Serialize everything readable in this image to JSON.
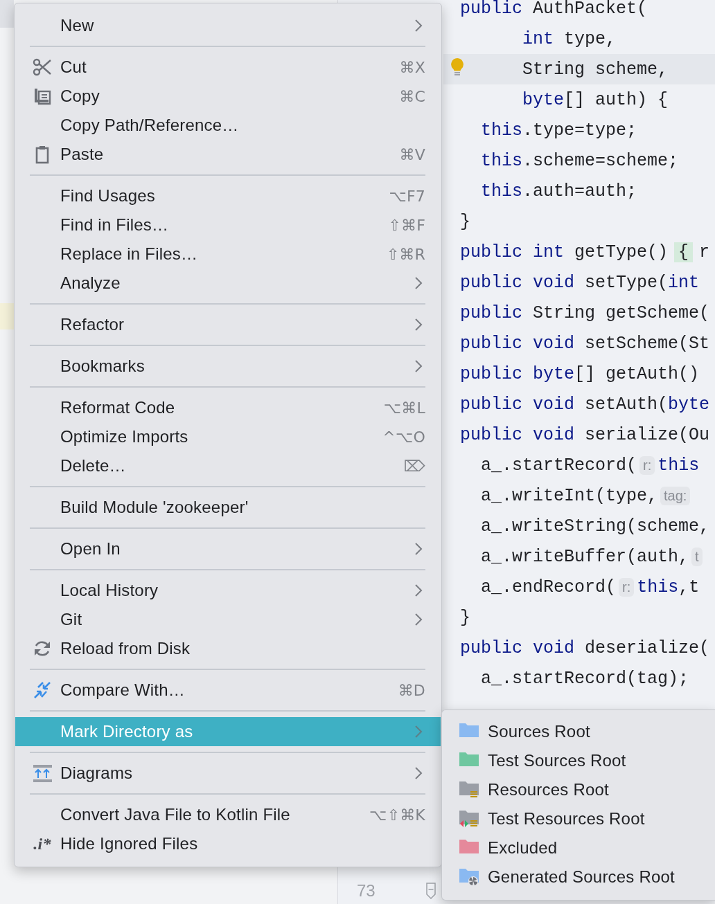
{
  "editor": {
    "lines": [
      {
        "current": false,
        "bulb": false,
        "segments": [
          {
            "kind": "keyword",
            "text": "public"
          },
          {
            "kind": "plain",
            "text": " AuthPacket("
          }
        ]
      },
      {
        "current": false,
        "bulb": false,
        "segments": [
          {
            "kind": "keyword",
            "text": "      int"
          },
          {
            "kind": "plain",
            "text": " type,"
          }
        ]
      },
      {
        "current": true,
        "bulb": true,
        "segments": [
          {
            "kind": "plain",
            "text": "      String scheme,"
          }
        ]
      },
      {
        "current": false,
        "bulb": false,
        "segments": [
          {
            "kind": "keyword",
            "text": "      byte"
          },
          {
            "kind": "plain",
            "text": "[] auth) {"
          }
        ]
      },
      {
        "current": false,
        "bulb": false,
        "segments": [
          {
            "kind": "keyword",
            "text": "  this"
          },
          {
            "kind": "plain",
            "text": ".type=type;"
          }
        ]
      },
      {
        "current": false,
        "bulb": false,
        "segments": [
          {
            "kind": "keyword",
            "text": "  this"
          },
          {
            "kind": "plain",
            "text": ".scheme=scheme;"
          }
        ]
      },
      {
        "current": false,
        "bulb": false,
        "segments": [
          {
            "kind": "keyword",
            "text": "  this"
          },
          {
            "kind": "plain",
            "text": ".auth=auth;"
          }
        ]
      },
      {
        "current": false,
        "bulb": false,
        "segments": [
          {
            "kind": "plain",
            "text": "}"
          }
        ]
      },
      {
        "current": false,
        "bulb": false,
        "segments": [
          {
            "kind": "keyword",
            "text": "public int"
          },
          {
            "kind": "plain",
            "text": " getType() "
          },
          {
            "kind": "brace",
            "text": "{"
          },
          {
            "kind": "plain",
            "text": " r"
          }
        ]
      },
      {
        "current": false,
        "bulb": false,
        "segments": [
          {
            "kind": "keyword",
            "text": "public void"
          },
          {
            "kind": "plain",
            "text": " setType("
          },
          {
            "kind": "keyword",
            "text": "int"
          }
        ]
      },
      {
        "current": false,
        "bulb": false,
        "segments": [
          {
            "kind": "keyword",
            "text": "public"
          },
          {
            "kind": "plain",
            "text": " String getScheme("
          }
        ]
      },
      {
        "current": false,
        "bulb": false,
        "segments": [
          {
            "kind": "keyword",
            "text": "public void"
          },
          {
            "kind": "plain",
            "text": " setScheme(St"
          }
        ]
      },
      {
        "current": false,
        "bulb": false,
        "segments": [
          {
            "kind": "keyword",
            "text": "public byte"
          },
          {
            "kind": "plain",
            "text": "[] getAuth()"
          }
        ]
      },
      {
        "current": false,
        "bulb": false,
        "segments": [
          {
            "kind": "keyword",
            "text": "public void"
          },
          {
            "kind": "plain",
            "text": " setAuth("
          },
          {
            "kind": "keyword",
            "text": "byte"
          }
        ]
      },
      {
        "current": false,
        "bulb": false,
        "segments": [
          {
            "kind": "keyword",
            "text": "public void"
          },
          {
            "kind": "plain",
            "text": " serialize(Ou"
          }
        ]
      },
      {
        "current": false,
        "bulb": false,
        "segments": [
          {
            "kind": "plain",
            "text": "  a_.startRecord("
          },
          {
            "kind": "hint",
            "text": "r:"
          },
          {
            "kind": "keyword",
            "text": "this"
          }
        ]
      },
      {
        "current": false,
        "bulb": false,
        "segments": [
          {
            "kind": "plain",
            "text": "  a_.writeInt(type,"
          },
          {
            "kind": "hint",
            "text": "tag:"
          }
        ]
      },
      {
        "current": false,
        "bulb": false,
        "segments": [
          {
            "kind": "plain",
            "text": "  a_.writeString(scheme,"
          }
        ]
      },
      {
        "current": false,
        "bulb": false,
        "segments": [
          {
            "kind": "plain",
            "text": "  a_.writeBuffer(auth,"
          },
          {
            "kind": "hint",
            "text": "t"
          }
        ]
      },
      {
        "current": false,
        "bulb": false,
        "segments": [
          {
            "kind": "plain",
            "text": "  a_.endRecord("
          },
          {
            "kind": "hint",
            "text": "r:"
          },
          {
            "kind": "keyword",
            "text": "this"
          },
          {
            "kind": "plain",
            "text": ",t"
          }
        ]
      },
      {
        "current": false,
        "bulb": false,
        "segments": [
          {
            "kind": "plain",
            "text": "}"
          }
        ]
      },
      {
        "current": false,
        "bulb": false,
        "segments": [
          {
            "kind": "keyword",
            "text": "public void"
          },
          {
            "kind": "plain",
            "text": " deserialize("
          }
        ]
      },
      {
        "current": false,
        "bulb": false,
        "segments": [
          {
            "kind": "plain",
            "text": "  a_.startRecord(tag);"
          }
        ]
      }
    ],
    "gutter": {
      "line_number": "73"
    }
  },
  "context_menu": {
    "groups": [
      {
        "items": [
          {
            "label": "New",
            "has_submenu": true,
            "selected": false
          }
        ]
      },
      {
        "items": [
          {
            "label": "Cut",
            "shortcut": "⌘X",
            "has_submenu": false,
            "selected": false
          },
          {
            "label": "Copy",
            "shortcut": "⌘C",
            "has_submenu": false,
            "selected": false
          },
          {
            "label": "Copy Path/Reference…",
            "has_submenu": false,
            "selected": false
          },
          {
            "label": "Paste",
            "shortcut": "⌘V",
            "has_submenu": false,
            "selected": false
          }
        ]
      },
      {
        "items": [
          {
            "label": "Find Usages",
            "shortcut": "⌥F7",
            "has_submenu": false,
            "selected": false
          },
          {
            "label": "Find in Files…",
            "shortcut": "⇧⌘F",
            "has_submenu": false,
            "selected": false
          },
          {
            "label": "Replace in Files…",
            "shortcut": "⇧⌘R",
            "has_submenu": false,
            "selected": false
          },
          {
            "label": "Analyze",
            "has_submenu": true,
            "selected": false
          }
        ]
      },
      {
        "items": [
          {
            "label": "Refactor",
            "has_submenu": true,
            "selected": false
          }
        ]
      },
      {
        "items": [
          {
            "label": "Bookmarks",
            "has_submenu": true,
            "selected": false
          }
        ]
      },
      {
        "items": [
          {
            "label": "Reformat Code",
            "shortcut": "⌥⌘L",
            "has_submenu": false,
            "selected": false
          },
          {
            "label": "Optimize Imports",
            "shortcut": "^⌥O",
            "has_submenu": false,
            "selected": false
          },
          {
            "label": "Delete…",
            "shortcut": "⌦",
            "has_submenu": false,
            "selected": false
          }
        ]
      },
      {
        "items": [
          {
            "label": "Build Module 'zookeeper'",
            "has_submenu": false,
            "selected": false
          }
        ]
      },
      {
        "items": [
          {
            "label": "Open In",
            "has_submenu": true,
            "selected": false
          }
        ]
      },
      {
        "items": [
          {
            "label": "Local History",
            "has_submenu": true,
            "selected": false
          },
          {
            "label": "Git",
            "has_submenu": true,
            "selected": false
          },
          {
            "label": "Reload from Disk",
            "has_submenu": false,
            "selected": false
          }
        ]
      },
      {
        "items": [
          {
            "label": "Compare With…",
            "shortcut": "⌘D",
            "has_submenu": false,
            "selected": false
          }
        ]
      },
      {
        "items": [
          {
            "label": "Mark Directory as",
            "has_submenu": true,
            "selected": true
          }
        ]
      },
      {
        "items": [
          {
            "label": "Diagrams",
            "has_submenu": true,
            "selected": false
          }
        ]
      },
      {
        "items": [
          {
            "label": "Convert Java File to Kotlin File",
            "shortcut": "⌥⇧⌘K",
            "has_submenu": false,
            "selected": false
          },
          {
            "label": "Hide Ignored Files",
            "icon_text": ".i*",
            "has_submenu": false,
            "selected": false
          }
        ]
      }
    ]
  },
  "submenu": {
    "items": [
      {
        "label": "Sources Root",
        "color": "#8ab9f1"
      },
      {
        "label": "Test Sources Root",
        "color": "#6fc7a0"
      },
      {
        "label": "Resources Root",
        "color": "#9a9ea6"
      },
      {
        "label": "Test Resources Root",
        "color": "#9a9ea6"
      },
      {
        "label": "Excluded",
        "color": "#e5899b"
      },
      {
        "label": "Generated Sources Root",
        "color": "#8ab9f1"
      }
    ]
  }
}
